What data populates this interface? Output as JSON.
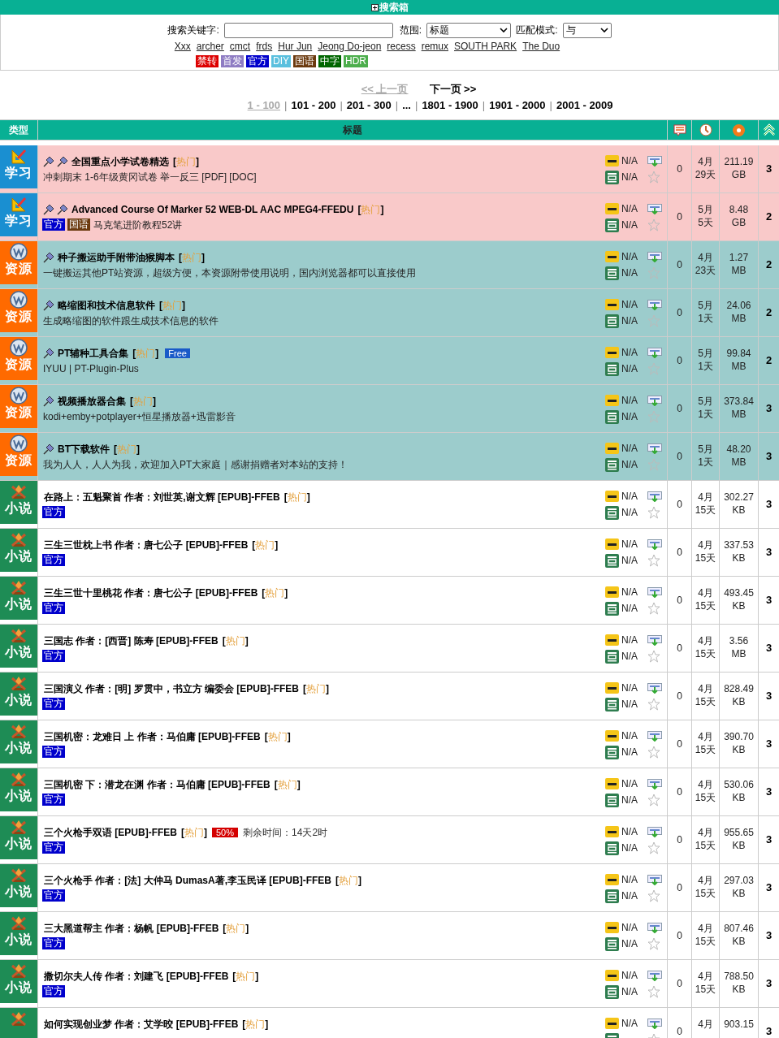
{
  "search_box": {
    "title": "搜索箱",
    "keyword_label": "搜索关键字:",
    "scope_label": "范围:",
    "scope_value": "标题",
    "mode_label": "匹配模式:",
    "mode_value": "与",
    "keywords": [
      "Xxx",
      "archer",
      "cmct",
      "frds",
      "Hur Jun",
      "Jeong Do-jeon",
      "recess",
      "remux",
      "SOUTH PARK",
      "The Duo"
    ],
    "tags": [
      {
        "label": "禁转",
        "color": "#dd0000"
      },
      {
        "label": "首发",
        "color": "#8e7cc3"
      },
      {
        "label": "官方",
        "color": "#0000cc"
      },
      {
        "label": "DIY",
        "color": "#5bc0de"
      },
      {
        "label": "国语",
        "color": "#6b3a0f"
      },
      {
        "label": "中字",
        "color": "#006600"
      },
      {
        "label": "HDR",
        "color": "#4cae4c"
      }
    ]
  },
  "pagination": {
    "prev": {
      "label": "<< 上一页",
      "disabled": true
    },
    "next": {
      "label": "下一页 >>",
      "disabled": false
    },
    "pages": [
      {
        "kind": "page",
        "label": "1 - 100",
        "selected": true
      },
      {
        "kind": "sep",
        "label": "|"
      },
      {
        "kind": "page",
        "label": "101 - 200",
        "selected": false
      },
      {
        "kind": "sep",
        "label": "|"
      },
      {
        "kind": "page",
        "label": "201 - 300",
        "selected": false
      },
      {
        "kind": "sep",
        "label": "|"
      },
      {
        "kind": "page",
        "label": "...",
        "selected": false
      },
      {
        "kind": "sep",
        "label": "|"
      },
      {
        "kind": "page",
        "label": "1801 - 1900",
        "selected": false
      },
      {
        "kind": "sep",
        "label": "|"
      },
      {
        "kind": "page",
        "label": "1901 - 2000",
        "selected": false
      },
      {
        "kind": "sep",
        "label": "|"
      },
      {
        "kind": "page",
        "label": "2001 - 2009",
        "selected": false
      }
    ]
  },
  "table": {
    "columns": [
      "类型",
      "标题"
    ],
    "rows": [
      {
        "category": {
          "kind": "study",
          "label": "学习"
        },
        "kind": "double",
        "title": "全国重点小学试卷精选",
        "hot": "[热门]",
        "tags": [],
        "subtitle": "冲刺期末 1-6年级黄冈试卷 举一反三 [PDF] [DOC]",
        "imdb": "N/A",
        "douban": "N/A",
        "comments": "0",
        "time": [
          "4月",
          "29天"
        ],
        "size": [
          "211.19",
          "GB"
        ],
        "seeders": "3"
      },
      {
        "category": {
          "kind": "study",
          "label": "学习"
        },
        "kind": "double",
        "title": "Advanced Course Of Marker 52 WEB-DL AAC MPEG4-FFEDU",
        "hot": "[热门]",
        "tags": [
          {
            "label": "官方",
            "color": "#0000cc"
          },
          {
            "label": "国语",
            "color": "#6b3a0f"
          }
        ],
        "subtitle": "马克笔进阶教程52讲",
        "imdb": "N/A",
        "douban": "N/A",
        "comments": "0",
        "time": [
          "5月",
          "5天"
        ],
        "size": [
          "8.48",
          "GB"
        ],
        "seeders": "2"
      },
      {
        "category": {
          "kind": "resource",
          "label": "资源"
        },
        "kind": "single",
        "title": "种子搬运助手附带油猴脚本",
        "hot": "[热门]",
        "tags": [],
        "subtitle": "一键搬运其他PT站资源，超级方便，本资源附带使用说明，国内浏览器都可以直接使用",
        "imdb": "N/A",
        "douban": "N/A",
        "comments": "0",
        "time": [
          "4月",
          "23天"
        ],
        "size": [
          "1.27",
          "MB"
        ],
        "seeders": "2"
      },
      {
        "category": {
          "kind": "resource",
          "label": "资源"
        },
        "kind": "single",
        "title": "略缩图和技术信息软件",
        "hot": "[热门]",
        "tags": [],
        "subtitle": "生成略缩图的软件跟生成技术信息的软件",
        "imdb": "N/A",
        "douban": "N/A",
        "comments": "0",
        "time": [
          "5月",
          "1天"
        ],
        "size": [
          "24.06",
          "MB"
        ],
        "seeders": "2"
      },
      {
        "category": {
          "kind": "resource",
          "label": "资源"
        },
        "kind": "single",
        "title": "PT辅种工具合集",
        "hot": "[热门]",
        "free": "Free",
        "tags": [],
        "subtitle": "IYUU | PT-Plugin-Plus",
        "imdb": "N/A",
        "douban": "N/A",
        "comments": "0",
        "time": [
          "5月",
          "1天"
        ],
        "size": [
          "99.84",
          "MB"
        ],
        "seeders": "2"
      },
      {
        "category": {
          "kind": "resource",
          "label": "资源"
        },
        "kind": "single",
        "title": "视频播放器合集",
        "hot": "[热门]",
        "tags": [],
        "subtitle": "kodi+emby+potplayer+恒星播放器+迅雷影音",
        "imdb": "N/A",
        "douban": "N/A",
        "comments": "0",
        "time": [
          "5月",
          "1天"
        ],
        "size": [
          "373.84",
          "MB"
        ],
        "seeders": "3"
      },
      {
        "category": {
          "kind": "resource",
          "label": "资源"
        },
        "kind": "single",
        "title": "BT下载软件",
        "hot": "[热门]",
        "tags": [],
        "subtitle": "我为人人，人人为我，欢迎加入PT大家庭｜感谢捐赠者对本站的支持！",
        "imdb": "N/A",
        "douban": "N/A",
        "comments": "0",
        "time": [
          "5月",
          "1天"
        ],
        "size": [
          "48.20",
          "MB"
        ],
        "seeders": "3"
      },
      {
        "category": {
          "kind": "novel",
          "label": "小说"
        },
        "kind": "normal",
        "title": "在路上：五魁聚首 作者：刘世英,谢文辉 [EPUB]-FFEB",
        "hot": "[热门]",
        "tags": [
          {
            "label": "官方",
            "color": "#0000cc"
          }
        ],
        "imdb": "N/A",
        "douban": "N/A",
        "comments": "0",
        "time": [
          "4月",
          "15天"
        ],
        "size": [
          "302.27",
          "KB"
        ],
        "seeders": "3"
      },
      {
        "category": {
          "kind": "novel",
          "label": "小说"
        },
        "kind": "normal",
        "title": "三生三世枕上书 作者：唐七公子 [EPUB]-FFEB",
        "hot": "[热门]",
        "tags": [
          {
            "label": "官方",
            "color": "#0000cc"
          }
        ],
        "imdb": "N/A",
        "douban": "N/A",
        "comments": "0",
        "time": [
          "4月",
          "15天"
        ],
        "size": [
          "337.53",
          "KB"
        ],
        "seeders": "3"
      },
      {
        "category": {
          "kind": "novel",
          "label": "小说"
        },
        "kind": "normal",
        "title": "三生三世十里桃花 作者：唐七公子 [EPUB]-FFEB",
        "hot": "[热门]",
        "tags": [
          {
            "label": "官方",
            "color": "#0000cc"
          }
        ],
        "imdb": "N/A",
        "douban": "N/A",
        "comments": "0",
        "time": [
          "4月",
          "15天"
        ],
        "size": [
          "493.45",
          "KB"
        ],
        "seeders": "3"
      },
      {
        "category": {
          "kind": "novel",
          "label": "小说"
        },
        "kind": "normal",
        "title": "三国志 作者：[西晋] 陈寿 [EPUB]-FFEB",
        "hot": "[热门]",
        "tags": [
          {
            "label": "官方",
            "color": "#0000cc"
          }
        ],
        "imdb": "N/A",
        "douban": "N/A",
        "comments": "0",
        "time": [
          "4月",
          "15天"
        ],
        "size": [
          "3.56",
          "MB"
        ],
        "seeders": "3"
      },
      {
        "category": {
          "kind": "novel",
          "label": "小说"
        },
        "kind": "normal",
        "title": "三国演义 作者：[明] 罗贯中，书立方 编委会 [EPUB]-FFEB",
        "hot": "[热门]",
        "tags": [
          {
            "label": "官方",
            "color": "#0000cc"
          }
        ],
        "imdb": "N/A",
        "douban": "N/A",
        "comments": "0",
        "time": [
          "4月",
          "15天"
        ],
        "size": [
          "828.49",
          "KB"
        ],
        "seeders": "3"
      },
      {
        "category": {
          "kind": "novel",
          "label": "小说"
        },
        "kind": "normal",
        "title": "三国机密：龙难日 上 作者：马伯庸 [EPUB]-FFEB",
        "hot": "[热门]",
        "tags": [
          {
            "label": "官方",
            "color": "#0000cc"
          }
        ],
        "imdb": "N/A",
        "douban": "N/A",
        "comments": "0",
        "time": [
          "4月",
          "15天"
        ],
        "size": [
          "390.70",
          "KB"
        ],
        "seeders": "3"
      },
      {
        "category": {
          "kind": "novel",
          "label": "小说"
        },
        "kind": "normal",
        "title": "三国机密 下：潜龙在渊 作者：马伯庸 [EPUB]-FFEB",
        "hot": "[热门]",
        "tags": [
          {
            "label": "官方",
            "color": "#0000cc"
          }
        ],
        "imdb": "N/A",
        "douban": "N/A",
        "comments": "0",
        "time": [
          "4月",
          "15天"
        ],
        "size": [
          "530.06",
          "KB"
        ],
        "seeders": "3"
      },
      {
        "category": {
          "kind": "novel",
          "label": "小说"
        },
        "kind": "normal",
        "title": "三个火枪手双语 [EPUB]-FFEB",
        "hot": "[热门]",
        "discount": "50%",
        "remaining": "剩余时间：14天2时",
        "tags": [
          {
            "label": "官方",
            "color": "#0000cc"
          }
        ],
        "imdb": "N/A",
        "douban": "N/A",
        "comments": "0",
        "time": [
          "4月",
          "15天"
        ],
        "size": [
          "955.65",
          "KB"
        ],
        "seeders": "3"
      },
      {
        "category": {
          "kind": "novel",
          "label": "小说"
        },
        "kind": "normal",
        "title": "三个火枪手 作者：[法] 大仲马 DumasA著,李玉民译 [EPUB]-FFEB",
        "hot": "[热门]",
        "tags": [
          {
            "label": "官方",
            "color": "#0000cc"
          }
        ],
        "imdb": "N/A",
        "douban": "N/A",
        "comments": "0",
        "time": [
          "4月",
          "15天"
        ],
        "size": [
          "297.03",
          "KB"
        ],
        "seeders": "3"
      },
      {
        "category": {
          "kind": "novel",
          "label": "小说"
        },
        "kind": "normal",
        "title": "三大黑道帮主 作者：杨帆 [EPUB]-FFEB",
        "hot": "[热门]",
        "tags": [
          {
            "label": "官方",
            "color": "#0000cc"
          }
        ],
        "imdb": "N/A",
        "douban": "N/A",
        "comments": "0",
        "time": [
          "4月",
          "15天"
        ],
        "size": [
          "807.46",
          "KB"
        ],
        "seeders": "3"
      },
      {
        "category": {
          "kind": "novel",
          "label": "小说"
        },
        "kind": "normal",
        "title": "撒切尔夫人传 作者：刘建飞 [EPUB]-FFEB",
        "hot": "[热门]",
        "tags": [
          {
            "label": "官方",
            "color": "#0000cc"
          }
        ],
        "imdb": "N/A",
        "douban": "N/A",
        "comments": "0",
        "time": [
          "4月",
          "15天"
        ],
        "size": [
          "788.50",
          "KB"
        ],
        "seeders": "3"
      },
      {
        "category": {
          "kind": "novel"
        },
        "kind": "normal",
        "title": "如何实现创业梦 作者：艾学晈 [EPUB]-FFEB",
        "hot": "[热门]",
        "tags": [],
        "imdb": "N/A",
        "comments": "0",
        "time": [
          "4月"
        ],
        "size": [
          "903.15"
        ],
        "seeders": "3"
      }
    ]
  }
}
